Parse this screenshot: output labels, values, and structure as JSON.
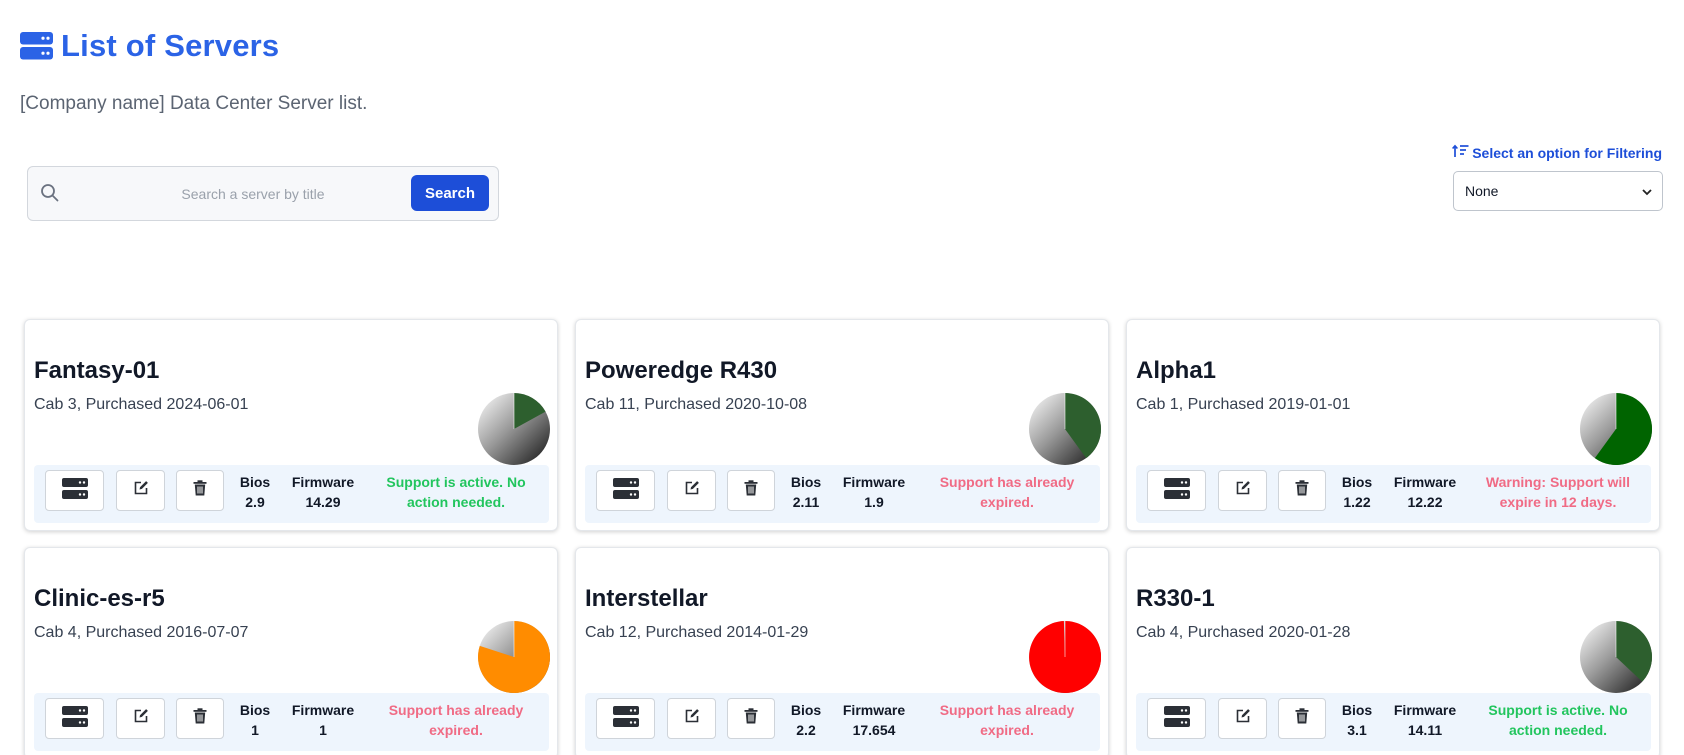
{
  "header": {
    "title": "List of Servers",
    "subtitle": "[Company name] Data Center Server list.",
    "icon": "server-stack-icon"
  },
  "search": {
    "placeholder": "Search a server by title",
    "value": "",
    "button_label": "Search",
    "icon": "search-icon"
  },
  "filter": {
    "label": "Select an option for Filtering",
    "icon": "sort-filter-icon",
    "selected": "None"
  },
  "colors": {
    "accent": "#2b63e6",
    "button": "#1d4ed8",
    "status_ok": "#22c55e",
    "status_bad": "#f06b85",
    "footer_bg": "#eef5fd"
  },
  "labels": {
    "bios": "Bios",
    "firmware": "Firmware"
  },
  "servers": [
    {
      "title": "Fantasy-01",
      "subtitle": "Cab 3, Purchased 2024-06-01",
      "bios": "2.9",
      "firmware": "14.29",
      "status": "Support is active. No action needed.",
      "status_color": "#22c55e",
      "pie_color": "#2d5f2e",
      "pie_fraction": 0.17
    },
    {
      "title": "Poweredge R430",
      "subtitle": "Cab 11, Purchased 2020-10-08",
      "bios": "2.11",
      "firmware": "1.9",
      "status": "Support has already expired.",
      "status_color": "#f06b85",
      "pie_color": "#2d5f2e",
      "pie_fraction": 0.4
    },
    {
      "title": "Alpha1",
      "subtitle": "Cab 1, Purchased 2019-01-01",
      "bios": "1.22",
      "firmware": "12.22",
      "status": "Warning: Support will expire in 12 days.",
      "status_color": "#f06b85",
      "pie_color": "#006400",
      "pie_fraction": 0.6
    },
    {
      "title": "Clinic-es-r5",
      "subtitle": "Cab 4, Purchased 2016-07-07",
      "bios": "1",
      "firmware": "1",
      "status": "Support has already expired.",
      "status_color": "#f06b85",
      "pie_color": "#ff8c00",
      "pie_fraction": 0.8
    },
    {
      "title": "Interstellar",
      "subtitle": "Cab 12, Purchased 2014-01-29",
      "bios": "2.2",
      "firmware": "17.654",
      "status": "Support has already expired.",
      "status_color": "#f06b85",
      "pie_color": "#ff0000",
      "pie_fraction": 0.995
    },
    {
      "title": "R330-1",
      "subtitle": "Cab 4, Purchased 2020-01-28",
      "bios": "3.1",
      "firmware": "14.11",
      "status": "Support is active. No action needed.",
      "status_color": "#22c55e",
      "pie_color": "#2d5f2e",
      "pie_fraction": 0.37
    }
  ]
}
